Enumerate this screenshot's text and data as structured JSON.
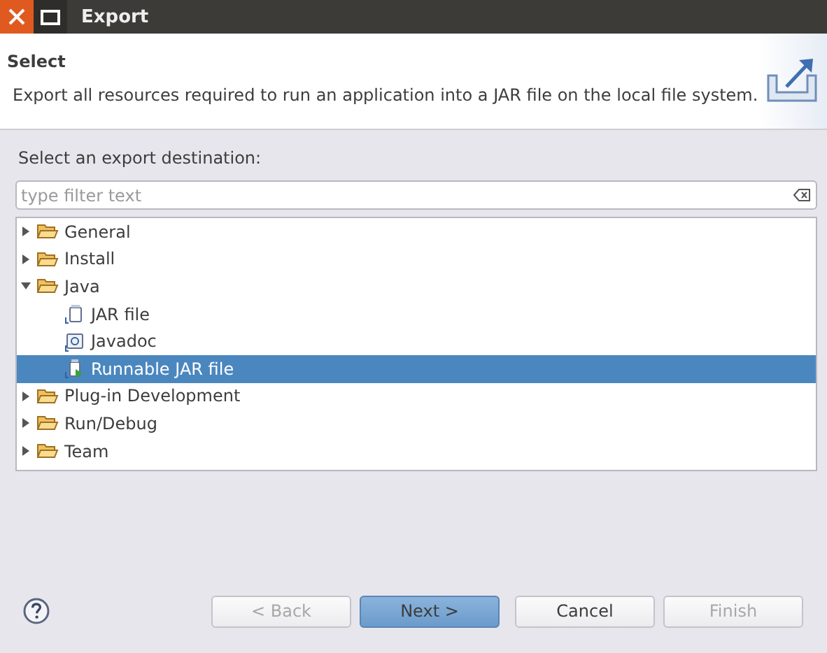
{
  "window": {
    "title": "Export"
  },
  "header": {
    "title": "Select",
    "description": "Export all resources required to run an application into a JAR file on the local file system."
  },
  "destination_label": "Select an export destination:",
  "filter": {
    "placeholder": "type filter text"
  },
  "tree": [
    {
      "label": "General",
      "kind": "folder",
      "expanded": false,
      "selected": false
    },
    {
      "label": "Install",
      "kind": "folder",
      "expanded": false,
      "selected": false
    },
    {
      "label": "Java",
      "kind": "folder",
      "expanded": true,
      "selected": false,
      "children": [
        {
          "label": "JAR file",
          "kind": "jar",
          "selected": false
        },
        {
          "label": "Javadoc",
          "kind": "javadoc",
          "selected": false
        },
        {
          "label": "Runnable JAR file",
          "kind": "runnable-jar",
          "selected": true
        }
      ]
    },
    {
      "label": "Plug-in Development",
      "kind": "folder",
      "expanded": false,
      "selected": false
    },
    {
      "label": "Run/Debug",
      "kind": "folder",
      "expanded": false,
      "selected": false
    },
    {
      "label": "Team",
      "kind": "folder",
      "expanded": false,
      "selected": false
    }
  ],
  "buttons": [
    {
      "label": "< Back",
      "disabled": true,
      "default": false
    },
    {
      "label": "Next >",
      "disabled": false,
      "default": true
    },
    {
      "label": "Cancel",
      "disabled": false,
      "default": false
    },
    {
      "label": "Finish",
      "disabled": true,
      "default": false
    }
  ]
}
